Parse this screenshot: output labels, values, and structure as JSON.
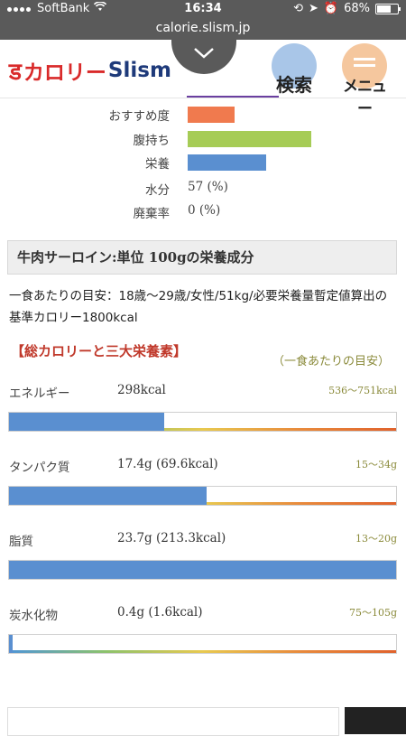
{
  "status": {
    "carrier": "SoftBank",
    "time": "16:34",
    "battery": "68%"
  },
  "browser": {
    "url": "calorie.slism.jp"
  },
  "header": {
    "logo_kana": "カロリー",
    "logo_latin": "Slism",
    "search_label": "検索",
    "menu_label": "メニュー",
    "colors": {
      "logo_red": "#d92a2a",
      "logo_blue": "#2b6cc4"
    }
  },
  "indicators": [
    {
      "label": "おすすめ度",
      "level": 0.25,
      "color": "#f07a4e"
    },
    {
      "label": "腹持ち",
      "level": 0.66,
      "color": "#a6cc56"
    },
    {
      "label": "栄養",
      "level": 0.42,
      "color": "#5a8fd0"
    }
  ],
  "facts": [
    {
      "label": "水分",
      "value": "57 (%)"
    },
    {
      "label": "廃棄率",
      "value": "0 (%)"
    }
  ],
  "section": {
    "title": "牛肉サーロイン:単位 100gの栄養成分",
    "intro": "一食あたりの目安：18歳〜29歳/女性/51kg/必要栄養量暫定値算出の基準カロリー1800kcal",
    "subheading": "【総カロリーと三大栄養素】",
    "note": "（一食あたりの目安）"
  },
  "nutrients": [
    {
      "name": "エネルギー",
      "amount": "298kcal",
      "range": "536〜751kcal",
      "fill": 0.4
    },
    {
      "name": "タンパク質",
      "amount": "17.4g (69.6kcal)",
      "range": "15〜34g",
      "fill": 0.51
    },
    {
      "name": "脂質",
      "amount": "23.7g (213.3kcal)",
      "range": "13〜20g",
      "fill": 1.0
    },
    {
      "name": "炭水化物",
      "amount": "0.4g (1.6kcal)",
      "range": "75〜105g",
      "fill": 0.01
    }
  ]
}
